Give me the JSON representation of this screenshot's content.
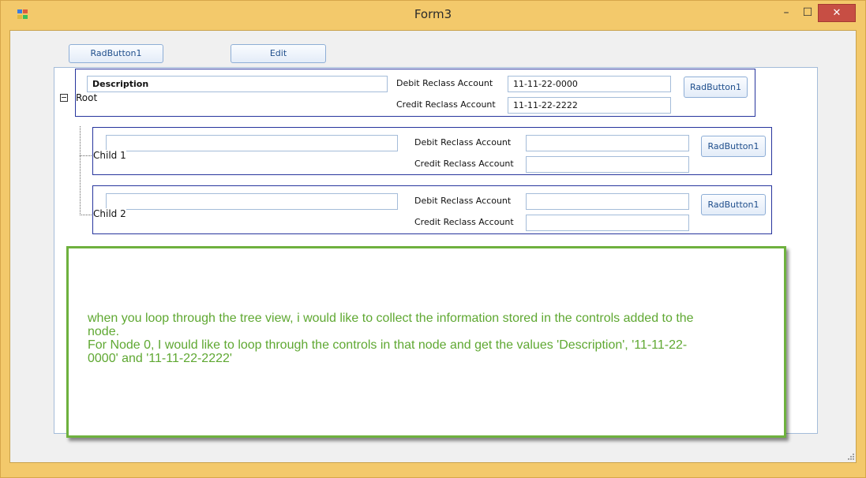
{
  "window": {
    "title": "Form3",
    "minimize_glyph": "–",
    "maximize_glyph": "☐",
    "close_glyph": "✕"
  },
  "toolbar": {
    "button1_label": "RadButton1",
    "edit_label": "Edit"
  },
  "tree": {
    "root": {
      "label": "Root",
      "description_value": "Description",
      "debit_label": "Debit Reclass Account",
      "debit_value": "11-11-22-0000",
      "credit_label": "Credit Reclass Account",
      "credit_value": "11-11-22-2222",
      "button_label": "RadButton1"
    },
    "children": [
      {
        "label": "Child 1",
        "description_value": "",
        "debit_label": "Debit Reclass Account",
        "debit_value": "",
        "credit_label": "Credit Reclass Account",
        "credit_value": "",
        "button_label": "RadButton1"
      },
      {
        "label": "Child 2",
        "description_value": "",
        "debit_label": "Debit Reclass Account",
        "debit_value": "",
        "credit_label": "Credit Reclass Account",
        "credit_value": "",
        "button_label": "RadButton1"
      }
    ]
  },
  "annotation": {
    "line1": "when you loop through the tree view, i would like to collect the information stored in the controls added to the",
    "line2": "node.",
    "line3": "For Node 0, I would like to loop through the controls in that node and get the values 'Description', '11-11-22-",
    "line4": "0000' and '11-11-22-2222'"
  },
  "colors": {
    "frame": "#f3c96b",
    "close": "#c74e44",
    "panel_border": "#27359d",
    "annotation": "#6eb13e"
  }
}
